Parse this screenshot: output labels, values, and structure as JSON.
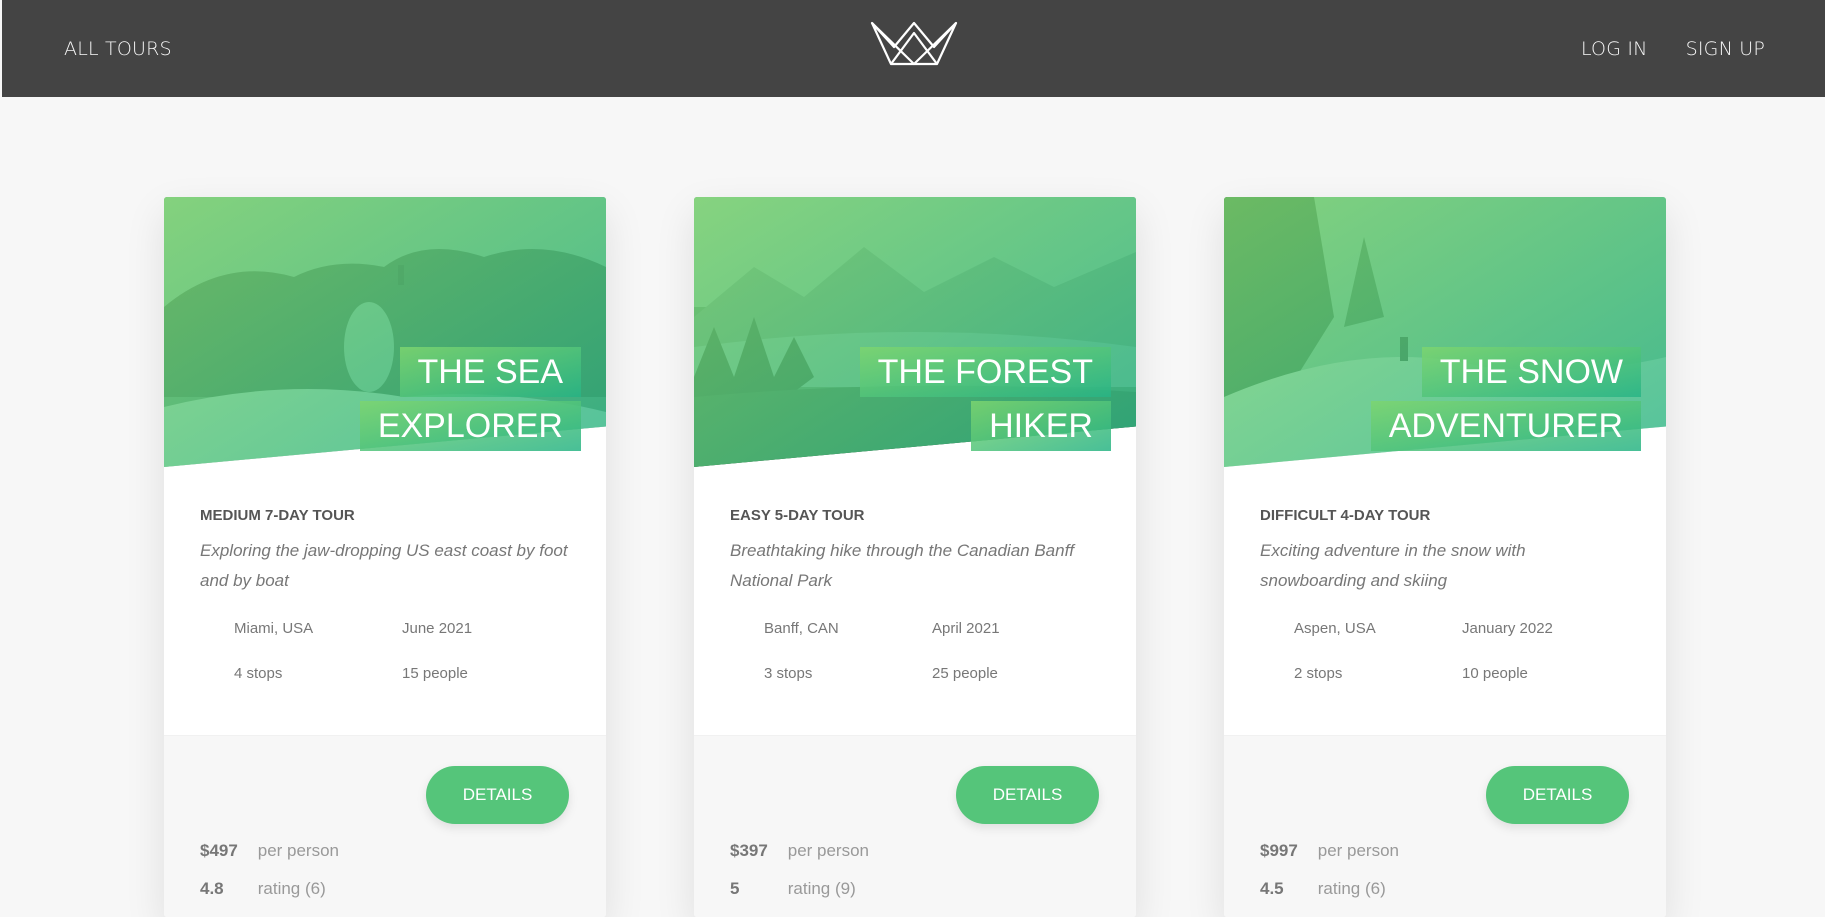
{
  "header": {
    "all_tours": "ALL TOURS",
    "login": "LOG IN",
    "signup": "SIGN UP"
  },
  "colors": {
    "accent": "#55c57a",
    "header_bg": "#444444",
    "page_bg": "#f7f7f7"
  },
  "tours": [
    {
      "title_line1": "THE SEA",
      "title_line2": "EXPLORER",
      "subheading": "MEDIUM 7-DAY TOUR",
      "summary": "Exploring the jaw-dropping US east coast by foot and by boat",
      "location": "Miami, USA",
      "date": "June 2021",
      "stops": "4 stops",
      "people": "15 people",
      "details": "DETAILS",
      "price": "$497",
      "price_text": "per person",
      "rating": "4.8",
      "rating_text": "rating (6)"
    },
    {
      "title_line1": "THE FOREST",
      "title_line2": "HIKER",
      "subheading": "EASY 5-DAY TOUR",
      "summary": "Breathtaking hike through the Canadian Banff National Park",
      "location": "Banff, CAN",
      "date": "April 2021",
      "stops": "3 stops",
      "people": "25 people",
      "details": "DETAILS",
      "price": "$397",
      "price_text": "per person",
      "rating": "5",
      "rating_text": "rating (9)"
    },
    {
      "title_line1": "THE SNOW",
      "title_line2": "ADVENTURER",
      "subheading": "DIFFICULT 4-DAY TOUR",
      "summary": "Exciting adventure in the snow with snowboarding and skiing",
      "location": "Aspen, USA",
      "date": "January 2022",
      "stops": "2 stops",
      "people": "10 people",
      "details": "DETAILS",
      "price": "$997",
      "price_text": "per person",
      "rating": "4.5",
      "rating_text": "rating (6)"
    }
  ]
}
